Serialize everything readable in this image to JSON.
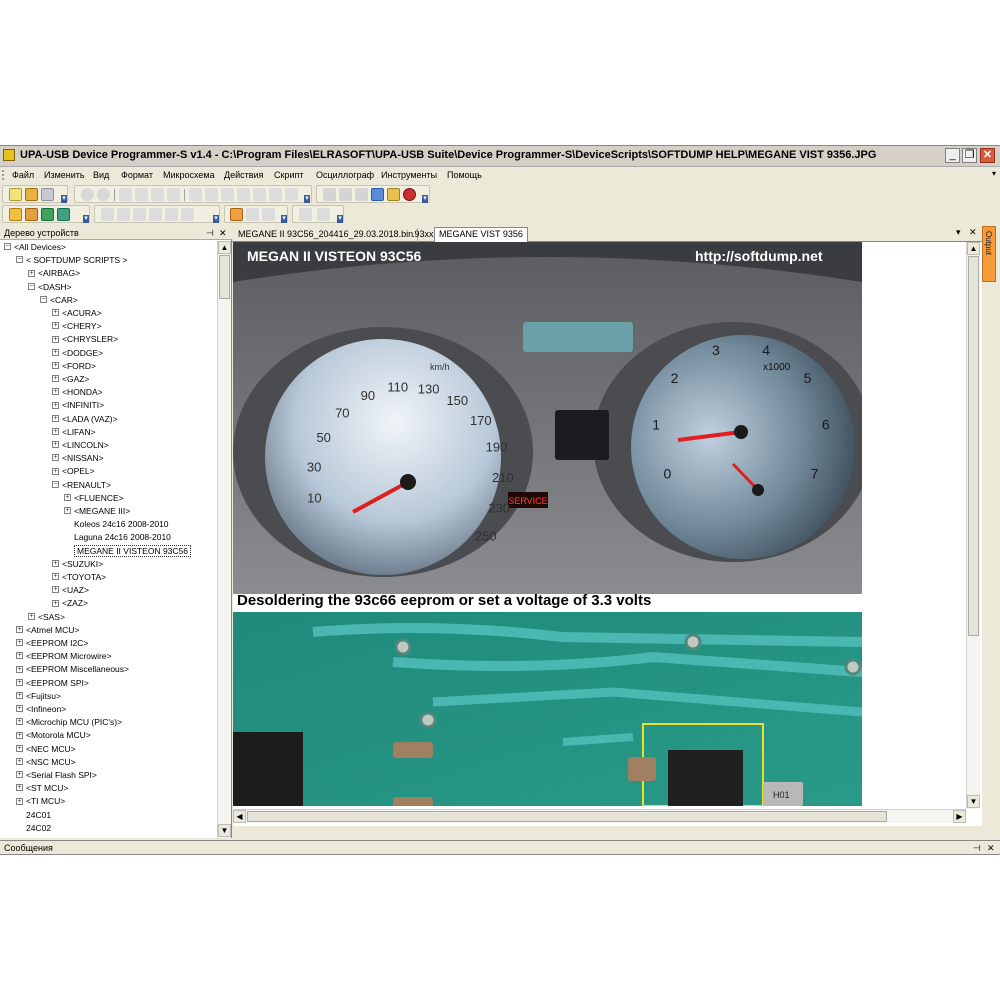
{
  "window": {
    "title": "UPA-USB Device Programmer-S v1.4 - C:\\Program Files\\ELRASOFT\\UPA-USB Suite\\Device Programmer-S\\DeviceScripts\\SOFTDUMP HELP\\MEGANE VIST 9356.JPG"
  },
  "menu": [
    "Файл",
    "Изменить",
    "Вид",
    "Формат",
    "Микросхема",
    "Действия",
    "Скрипт",
    "Осциллограф",
    "Инструменты",
    "Помощь"
  ],
  "tree_panel": {
    "title": "Дерево устройств",
    "items": [
      {
        "label": "<All Devices>",
        "exp": "−"
      },
      {
        "label": "< SOFTDUMP SCRIPTS >",
        "exp": "−"
      },
      {
        "label": "<AIRBAG>",
        "exp": "+"
      },
      {
        "label": "<DASH>",
        "exp": "−"
      },
      {
        "label": "<CAR>",
        "exp": "−"
      },
      {
        "label": "<ACURA>",
        "exp": "+"
      },
      {
        "label": "<CHERY>",
        "exp": "+"
      },
      {
        "label": "<CHRYSLER>",
        "exp": "+"
      },
      {
        "label": "<DODGE>",
        "exp": "+"
      },
      {
        "label": "<FORD>",
        "exp": "+"
      },
      {
        "label": "<GAZ>",
        "exp": "+"
      },
      {
        "label": "<HONDA>",
        "exp": "+"
      },
      {
        "label": "<INFINITI>",
        "exp": "+"
      },
      {
        "label": "<LADA (VAZ)>",
        "exp": "+"
      },
      {
        "label": "<LIFAN>",
        "exp": "+"
      },
      {
        "label": "<LINCOLN>",
        "exp": "+"
      },
      {
        "label": "<NISSAN>",
        "exp": "+"
      },
      {
        "label": "<OPEL>",
        "exp": "+"
      },
      {
        "label": "<RENAULT>",
        "exp": "−"
      },
      {
        "label": "<FLUENCE>",
        "exp": "+"
      },
      {
        "label": "<MEGANE III>",
        "exp": "+"
      },
      {
        "label": "Koleos 24c16 2008-2010",
        "exp": ""
      },
      {
        "label": "Laguna 24c16 2008-2010",
        "exp": ""
      },
      {
        "label": "MEGANE II VISTEON 93C56",
        "exp": ""
      },
      {
        "label": "<SUZUKI>",
        "exp": "+"
      },
      {
        "label": "<TOYOTA>",
        "exp": "+"
      },
      {
        "label": "<UAZ>",
        "exp": "+"
      },
      {
        "label": "<ZAZ>",
        "exp": "+"
      },
      {
        "label": "<SAS>",
        "exp": "+"
      },
      {
        "label": "<Atmel MCU>",
        "exp": "+"
      },
      {
        "label": "<EEPROM I2C>",
        "exp": "+"
      },
      {
        "label": "<EEPROM Microwire>",
        "exp": "+"
      },
      {
        "label": "<EEPROM Miscellaneous>",
        "exp": "+"
      },
      {
        "label": "<EEPROM SPI>",
        "exp": "+"
      },
      {
        "label": "<Fujitsu>",
        "exp": "+"
      },
      {
        "label": "<Infineon>",
        "exp": "+"
      },
      {
        "label": "<Microchip MCU (PIC's)>",
        "exp": "+"
      },
      {
        "label": "<Motorola MCU>",
        "exp": "+"
      },
      {
        "label": "<NEC MCU>",
        "exp": "+"
      },
      {
        "label": "<NSC MCU>",
        "exp": "+"
      },
      {
        "label": "<Serial Flash SPI>",
        "exp": "+"
      },
      {
        "label": "<ST MCU>",
        "exp": "+"
      },
      {
        "label": "<TI MCU>",
        "exp": "+"
      },
      {
        "label": "24C01",
        "exp": ""
      },
      {
        "label": "24C02",
        "exp": ""
      }
    ]
  },
  "tabs": [
    "MEGANE II 93C56_204416_29.03.2018.bin",
    ".93xx",
    "MEGANE VIST 9356"
  ],
  "output_label": "Output",
  "status": {
    "label": "Сообщения"
  },
  "image": {
    "title_left": "MEGAN II VISTEON 93C56",
    "title_right": "http://softdump.net",
    "caption": "Desoldering the 93c66 eeprom or set a voltage of 3.3 volts",
    "speedo_ticks": [
      "10",
      "30",
      "50",
      "70",
      "90",
      "110",
      "130",
      "150",
      "170",
      "190",
      "210",
      "230",
      "250"
    ],
    "speedo_unit": "km/h",
    "tacho_ticks": [
      "0",
      "1",
      "2",
      "3",
      "4",
      "5",
      "6",
      "7"
    ],
    "tacho_unit": "x1000",
    "service_label": "SERVICE",
    "chip_label": "H01"
  }
}
